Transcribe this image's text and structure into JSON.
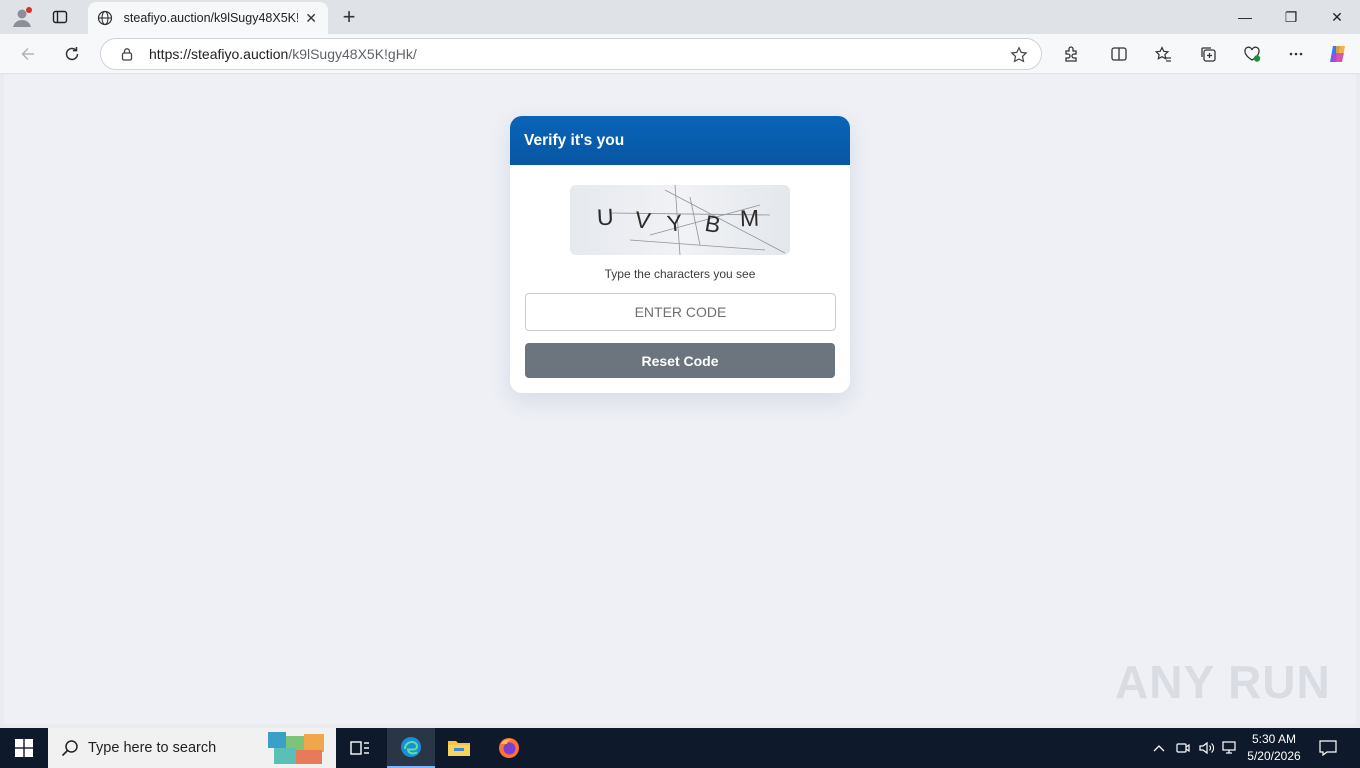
{
  "browser": {
    "tab_title": "steafiyo.auction/k9lSugy48X5K!gH",
    "tab_close": "✕",
    "new_tab": "+",
    "url_host": "https://steafiyo.auction",
    "url_path": "/k9lSugy48X5K!gHk/"
  },
  "window_controls": {
    "minimize": "—",
    "restore": "❐",
    "close": "✕"
  },
  "page": {
    "card_title": "Verify it's you",
    "captcha_chars": [
      "U",
      "V",
      "Y",
      "B",
      "M"
    ],
    "hint": "Type the characters you see",
    "input_placeholder": "ENTER CODE",
    "reset_button": "Reset Code"
  },
  "watermark": "ANY RUN",
  "taskbar": {
    "search_placeholder": "Type here to search",
    "time": "5:30 AM",
    "date": "5/20/2026"
  },
  "colors": {
    "header_blue": "#0a64b8",
    "button_gray": "#6c757d",
    "page_bg": "#eef0f6"
  }
}
